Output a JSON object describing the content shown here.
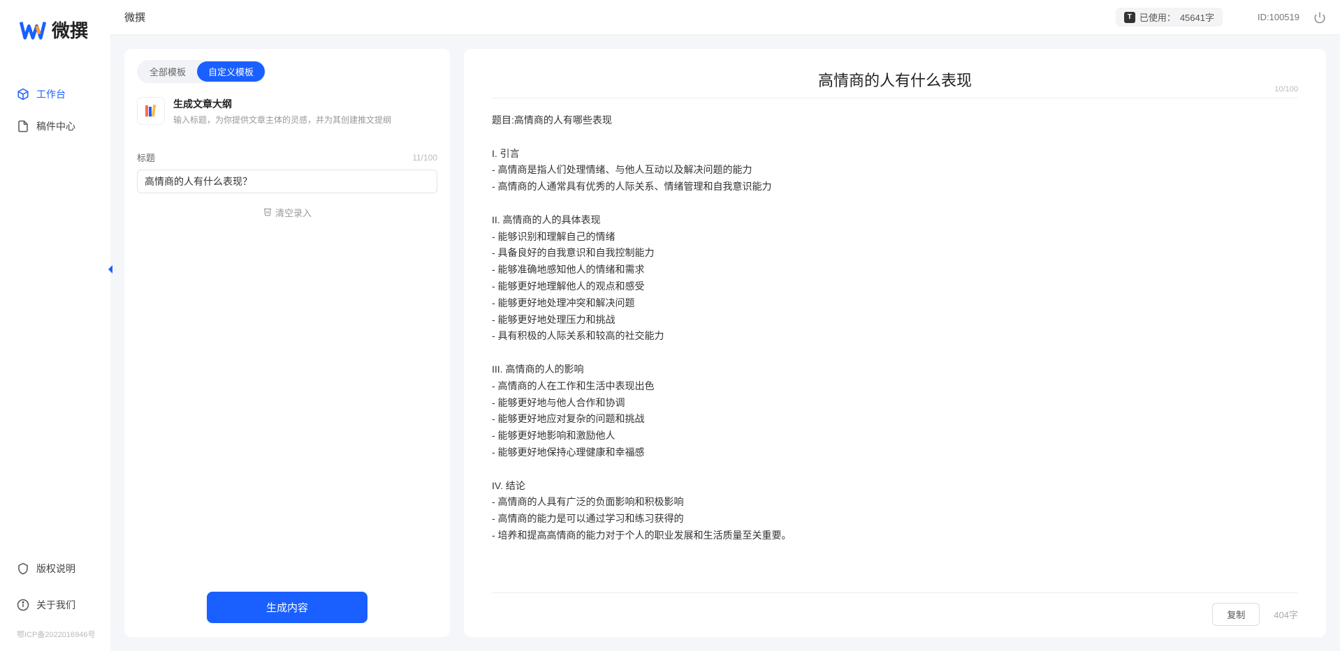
{
  "app": {
    "name": "微撰",
    "topbar_title": "微撰",
    "usage_label": "已使用：",
    "usage_value": "45641字",
    "user_id_label": "ID:",
    "user_id_value": "100519"
  },
  "sidebar": {
    "items": [
      {
        "label": "工作台",
        "active": true
      },
      {
        "label": "稿件中心",
        "active": false
      }
    ],
    "bottom": [
      {
        "label": "版权说明"
      },
      {
        "label": "关于我们"
      }
    ],
    "icp": "鄂ICP备2022016946号"
  },
  "left": {
    "tabs": [
      {
        "label": "全部模板",
        "active": false
      },
      {
        "label": "自定义模板",
        "active": true
      }
    ],
    "template": {
      "title": "生成文章大纲",
      "desc": "输入标题，为你提供文章主体的灵感，并为其创建推文提纲"
    },
    "form": {
      "label": "标题",
      "char_count": "11/100",
      "input_value": "高情商的人有什么表现？",
      "clear_label": "清空录入"
    },
    "generate_label": "生成内容"
  },
  "right": {
    "title": "高情商的人有什么表现",
    "title_count": "10/100",
    "body": "题目:高情商的人有哪些表现\n\nI. 引言\n- 高情商是指人们处理情绪、与他人互动以及解决问题的能力\n- 高情商的人通常具有优秀的人际关系、情绪管理和自我意识能力\n\nII. 高情商的人的具体表现\n- 能够识别和理解自己的情绪\n- 具备良好的自我意识和自我控制能力\n- 能够准确地感知他人的情绪和需求\n- 能够更好地理解他人的观点和感受\n- 能够更好地处理冲突和解决问题\n- 能够更好地处理压力和挑战\n- 具有积极的人际关系和较高的社交能力\n\nIII. 高情商的人的影响\n- 高情商的人在工作和生活中表现出色\n- 能够更好地与他人合作和协调\n- 能够更好地应对复杂的问题和挑战\n- 能够更好地影响和激励他人\n- 能够更好地保持心理健康和幸福感\n\nIV. 结论\n- 高情商的人具有广泛的负面影响和积极影响\n- 高情商的能力是可以通过学习和练习获得的\n- 培养和提高高情商的能力对于个人的职业发展和生活质量至关重要。",
    "copy_label": "复制",
    "word_count": "404字"
  }
}
